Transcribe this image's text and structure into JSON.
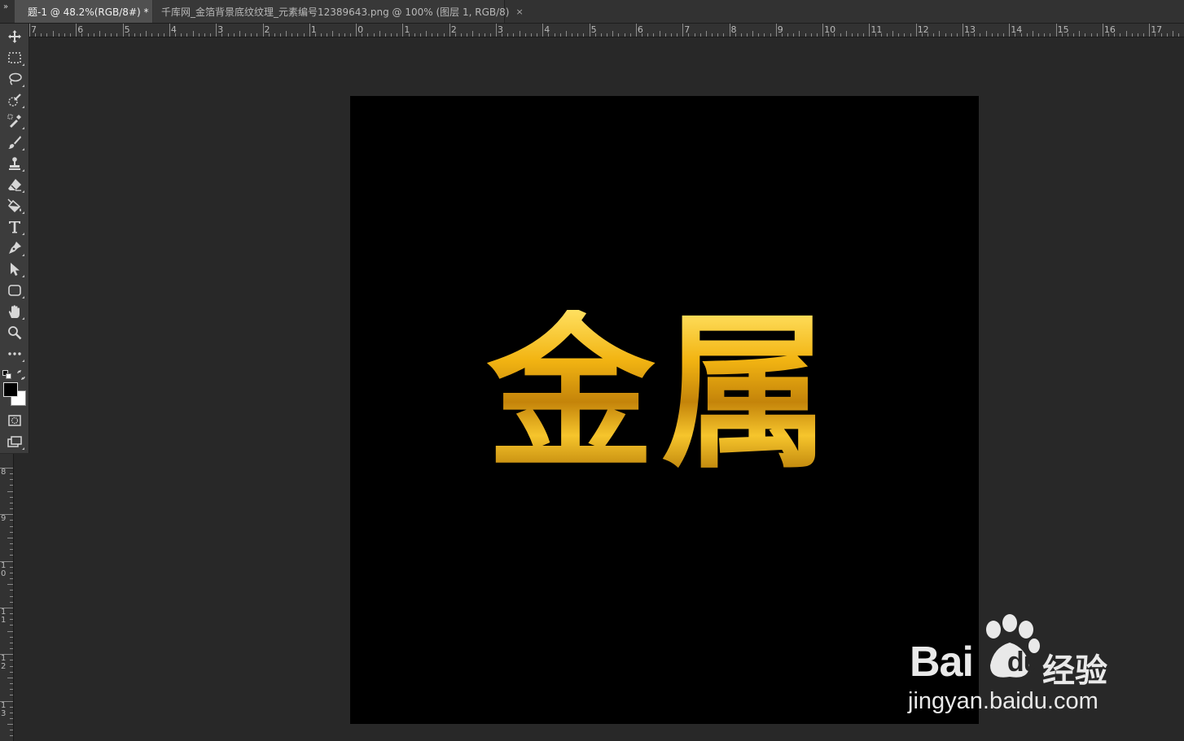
{
  "tabs": [
    {
      "label": "题-1 @ 48.2%(RGB/8#) *",
      "close": "×",
      "active": true
    },
    {
      "label": "千库网_金箔背景底纹纹理_元素编号12389643.png @ 100% (图层 1, RGB/8)",
      "close": "×",
      "active": false
    }
  ],
  "panel_collapse_glyph": "»",
  "ruler_top": {
    "labels": [
      "7",
      "6",
      "5",
      "4",
      "3",
      "2",
      "1",
      "0",
      "1",
      "2",
      "3",
      "4",
      "5",
      "6",
      "7",
      "8",
      "9",
      "10",
      "11",
      "12",
      "13",
      "14",
      "15",
      "16",
      "17"
    ]
  },
  "ruler_left": {
    "labels": [
      "8",
      "9",
      "10",
      "11",
      "12",
      "13"
    ]
  },
  "toolbar": {
    "tools": [
      {
        "name": "move-tool-icon"
      },
      {
        "name": "rectangular-marquee-tool-icon"
      },
      {
        "name": "lasso-tool-icon"
      },
      {
        "name": "quick-selection-tool-icon"
      },
      {
        "name": "eyedropper-tool-icon"
      },
      {
        "name": "brush-tool-icon"
      },
      {
        "name": "clone-stamp-tool-icon"
      },
      {
        "name": "eraser-tool-icon"
      },
      {
        "name": "paint-bucket-tool-icon"
      },
      {
        "name": "type-tool-icon"
      },
      {
        "name": "pen-tool-icon"
      },
      {
        "name": "path-selection-tool-icon"
      },
      {
        "name": "rectangle-tool-icon"
      },
      {
        "name": "hand-tool-icon"
      },
      {
        "name": "zoom-tool-icon"
      },
      {
        "name": "more-tools-icon"
      }
    ],
    "foreground_color": "#000000",
    "background_color": "#ffffff"
  },
  "canvas": {
    "background": "#000000",
    "text": "金属",
    "text_color_gold": "#f2b412"
  },
  "watermark": {
    "brand": "Bai",
    "brand_du": "du",
    "cn_label": "经验",
    "url": "jingyan.baidu.com"
  }
}
